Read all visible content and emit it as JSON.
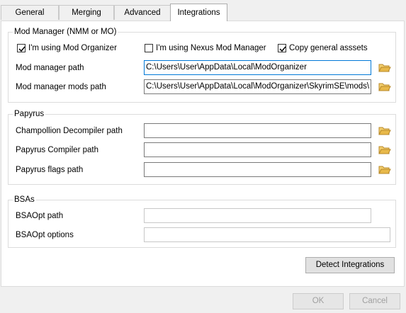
{
  "tabs": [
    {
      "label": "General"
    },
    {
      "label": "Merging"
    },
    {
      "label": "Advanced"
    },
    {
      "label": "Integrations"
    }
  ],
  "active_tab": "Integrations",
  "mod_manager": {
    "title": "Mod Manager (NMM or MO)",
    "checkboxes": [
      {
        "label": "I'm using Mod Organizer",
        "checked": true
      },
      {
        "label": "I'm using Nexus Mod Manager",
        "checked": false
      },
      {
        "label": "Copy general asssets",
        "checked": true
      }
    ],
    "path_label": "Mod manager path",
    "path_value": "C:\\Users\\User\\AppData\\Local\\ModOrganizer",
    "mods_path_label": "Mod manager mods path",
    "mods_path_value": "C:\\Users\\User\\AppData\\Local\\ModOrganizer\\SkyrimSE\\mods\\"
  },
  "papyrus": {
    "title": "Papyrus",
    "champollion_label": "Champollion Decompiler path",
    "champollion_value": "",
    "compiler_label": "Papyrus Compiler path",
    "compiler_value": "",
    "flags_label": "Papyrus flags path",
    "flags_value": ""
  },
  "bsas": {
    "title": "BSAs",
    "bsaopt_path_label": "BSAOpt path",
    "bsaopt_path_value": "",
    "bsaopt_options_label": "BSAOpt options",
    "bsaopt_options_value": ""
  },
  "buttons": {
    "detect": "Detect Integrations",
    "ok": "OK",
    "cancel": "Cancel"
  },
  "colors": {
    "folder_icon": "#e8b94a",
    "accent_border": "#0078d7"
  },
  "icons": [
    "folder-icon",
    "checkmark-icon"
  ]
}
